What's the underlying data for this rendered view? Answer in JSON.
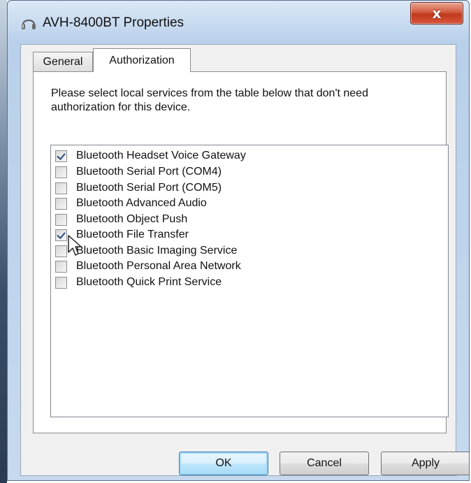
{
  "window": {
    "title": "AVH-8400BT Properties",
    "close_label": "x"
  },
  "tabs": [
    {
      "label": "General",
      "selected": false
    },
    {
      "label": "Authorization",
      "selected": true
    }
  ],
  "panel": {
    "instructions": "Please select local services from the table below that don't need authorization for this device."
  },
  "services": [
    {
      "label": "Bluetooth Headset Voice Gateway",
      "checked": true
    },
    {
      "label": "Bluetooth Serial Port (COM4)",
      "checked": false
    },
    {
      "label": "Bluetooth Serial Port (COM5)",
      "checked": false
    },
    {
      "label": "Bluetooth Advanced Audio",
      "checked": false
    },
    {
      "label": "Bluetooth Object Push",
      "checked": false
    },
    {
      "label": "Bluetooth File Transfer",
      "checked": true
    },
    {
      "label": "Bluetooth Basic Imaging Service",
      "checked": false
    },
    {
      "label": "Bluetooth Personal Area Network",
      "checked": false
    },
    {
      "label": "Bluetooth Quick Print Service",
      "checked": false
    }
  ],
  "buttons": {
    "ok": "OK",
    "cancel": "Cancel",
    "apply": "Apply"
  },
  "icons": {
    "title": "headset-icon",
    "cursor": "mouse-pointer-icon"
  },
  "colors": {
    "close_button": "#c0391c",
    "default_button_border": "#3c7fb1",
    "check_mark": "#2a4f8a"
  }
}
